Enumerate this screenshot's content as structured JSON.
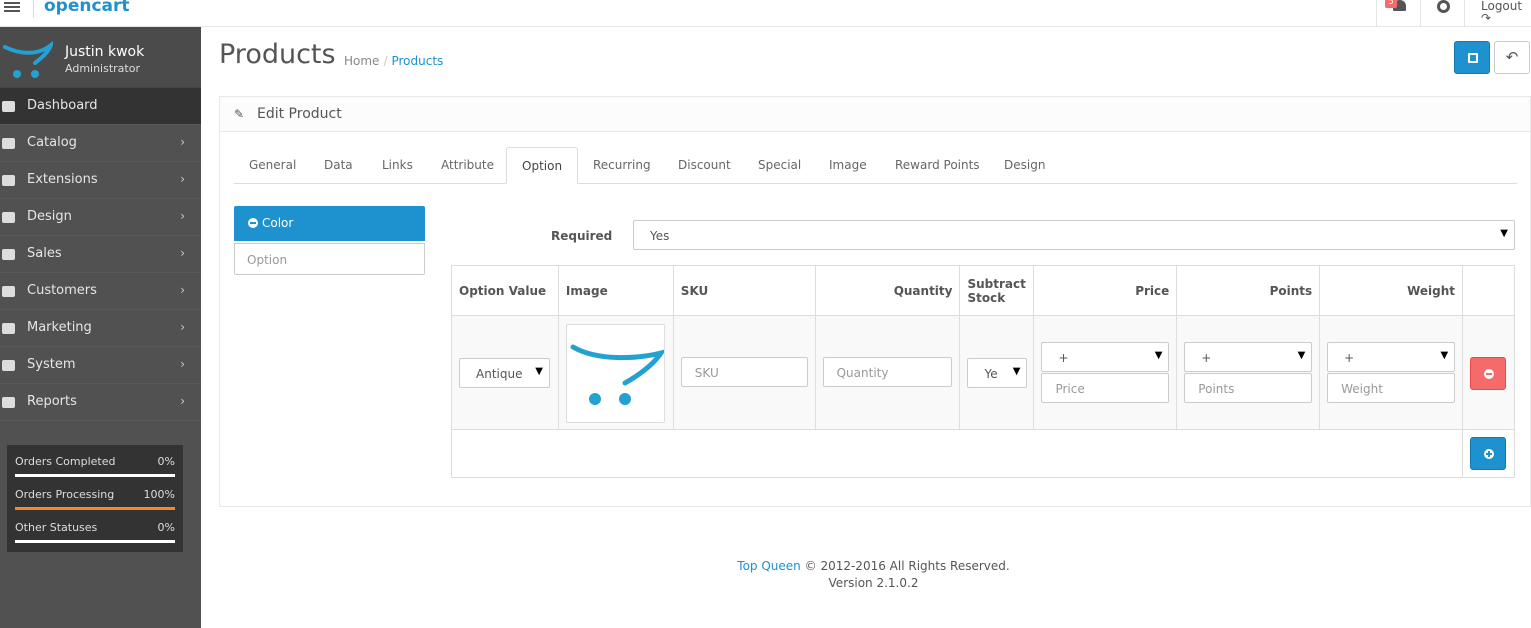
{
  "header": {
    "logo_text": "opencart",
    "notification_count": "5",
    "logout_label": "Logout"
  },
  "sidebar": {
    "user_name": "Justin kwok",
    "user_role": "Administrator",
    "items": [
      {
        "label": "Dashboard",
        "icon": "dashboard-icon"
      },
      {
        "label": "Catalog",
        "icon": "tags-icon"
      },
      {
        "label": "Extensions",
        "icon": "puzzle-icon"
      },
      {
        "label": "Design",
        "icon": "monitor-icon"
      },
      {
        "label": "Sales",
        "icon": "cart-icon"
      },
      {
        "label": "Customers",
        "icon": "user-icon"
      },
      {
        "label": "Marketing",
        "icon": "share-icon"
      },
      {
        "label": "System",
        "icon": "cog-icon"
      },
      {
        "label": "Reports",
        "icon": "bar-chart-icon"
      }
    ],
    "status": [
      {
        "label": "Orders Completed",
        "value": "0%",
        "fraction": 0
      },
      {
        "label": "Orders Processing",
        "value": "100%",
        "fraction": 1
      },
      {
        "label": "Other Statuses",
        "value": "0%",
        "fraction": 0
      }
    ]
  },
  "page": {
    "title": "Products",
    "breadcrumb": [
      "Home",
      "Products"
    ]
  },
  "panel": {
    "title": "Edit Product",
    "tabs": [
      "General",
      "Data",
      "Links",
      "Attribute",
      "Option",
      "Recurring",
      "Discount",
      "Special",
      "Image",
      "Reward Points",
      "Design"
    ],
    "active_tab": "Option"
  },
  "options": {
    "selected": "Color",
    "input_placeholder": "Option",
    "required_label": "Required",
    "required_value": "Yes"
  },
  "table": {
    "headers": [
      "Option Value",
      "Image",
      "SKU",
      "Quantity",
      "Subtract Stock",
      "Price",
      "Points",
      "Weight"
    ],
    "row": {
      "option_value": "Antique",
      "sku_placeholder": "SKU",
      "quantity_placeholder": "Quantity",
      "subtract_value": "Ye",
      "price_prefix": "+",
      "price_placeholder": "Price",
      "points_prefix": "+",
      "points_placeholder": "Points",
      "weight_prefix": "+",
      "weight_placeholder": "Weight"
    }
  },
  "footer": {
    "brand": "Top Queen",
    "copyright": "© 2012-2016 All Rights Reserved.",
    "version": "Version 2.1.0.2"
  }
}
